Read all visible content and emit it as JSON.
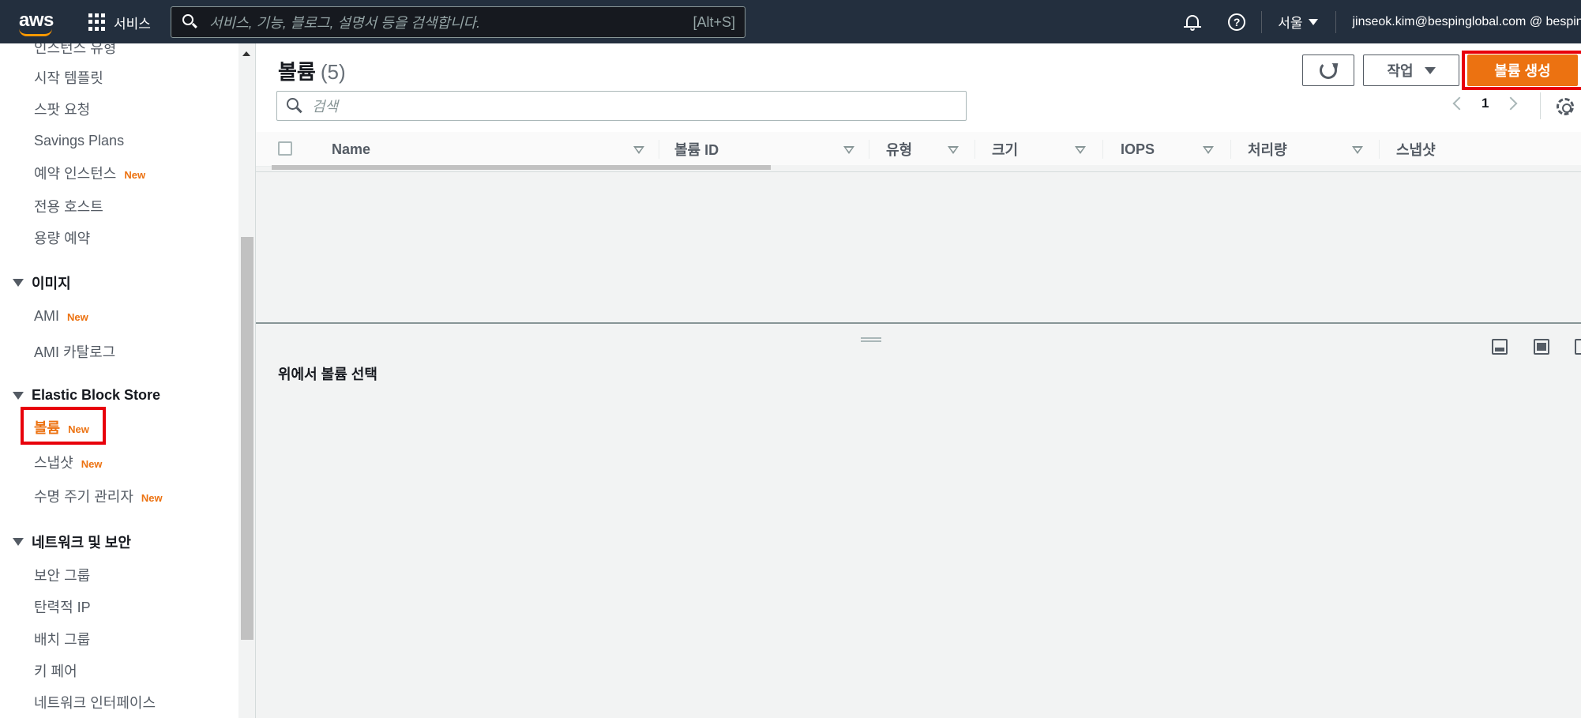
{
  "topnav": {
    "logo_text": "aws",
    "services_label": "서비스",
    "search_placeholder": "서비스, 기능, 블로그, 설명서 등을 검색합니다.",
    "search_shortcut": "[Alt+S]",
    "help_glyph": "?",
    "region": "서울",
    "account": "jinseok.kim@bespinglobal.com @ bespin-"
  },
  "sidebar": {
    "items_top": [
      {
        "label": "인스턴스 유형",
        "badge": ""
      },
      {
        "label": "시작 템플릿",
        "badge": ""
      },
      {
        "label": "스팟 요청",
        "badge": ""
      },
      {
        "label": "Savings Plans",
        "badge": ""
      },
      {
        "label": "예약 인스턴스",
        "badge": "New"
      },
      {
        "label": "전용 호스트",
        "badge": ""
      },
      {
        "label": "용량 예약",
        "badge": ""
      }
    ],
    "sections": [
      {
        "title": "이미지",
        "items": [
          {
            "label": "AMI",
            "badge": "New"
          },
          {
            "label": "AMI 카탈로그",
            "badge": ""
          }
        ]
      },
      {
        "title": "Elastic Block Store",
        "items": [
          {
            "label": "볼륨",
            "badge": "New"
          },
          {
            "label": "스냅샷",
            "badge": "New"
          },
          {
            "label": "수명 주기 관리자",
            "badge": "New"
          }
        ]
      },
      {
        "title": "네트워크 및 보안",
        "items": [
          {
            "label": "보안 그룹",
            "badge": ""
          },
          {
            "label": "탄력적 IP",
            "badge": ""
          },
          {
            "label": "배치 그룹",
            "badge": ""
          },
          {
            "label": "키 페어",
            "badge": ""
          },
          {
            "label": "네트워크 인터페이스",
            "badge": ""
          }
        ]
      }
    ]
  },
  "main": {
    "title": "볼륨",
    "count": "(5)",
    "actions_label": "작업",
    "create_label": "볼륨 생성",
    "search_placeholder": "검색",
    "page_number": "1",
    "columns": [
      "Name",
      "볼륨 ID",
      "유형",
      "크기",
      "IOPS",
      "처리량",
      "스냅샷"
    ],
    "detail_message": "위에서 볼륨 선택"
  },
  "colors": {
    "nav_bg": "#232f3e",
    "accent": "#ec7211",
    "highlight": "#e8000b"
  }
}
